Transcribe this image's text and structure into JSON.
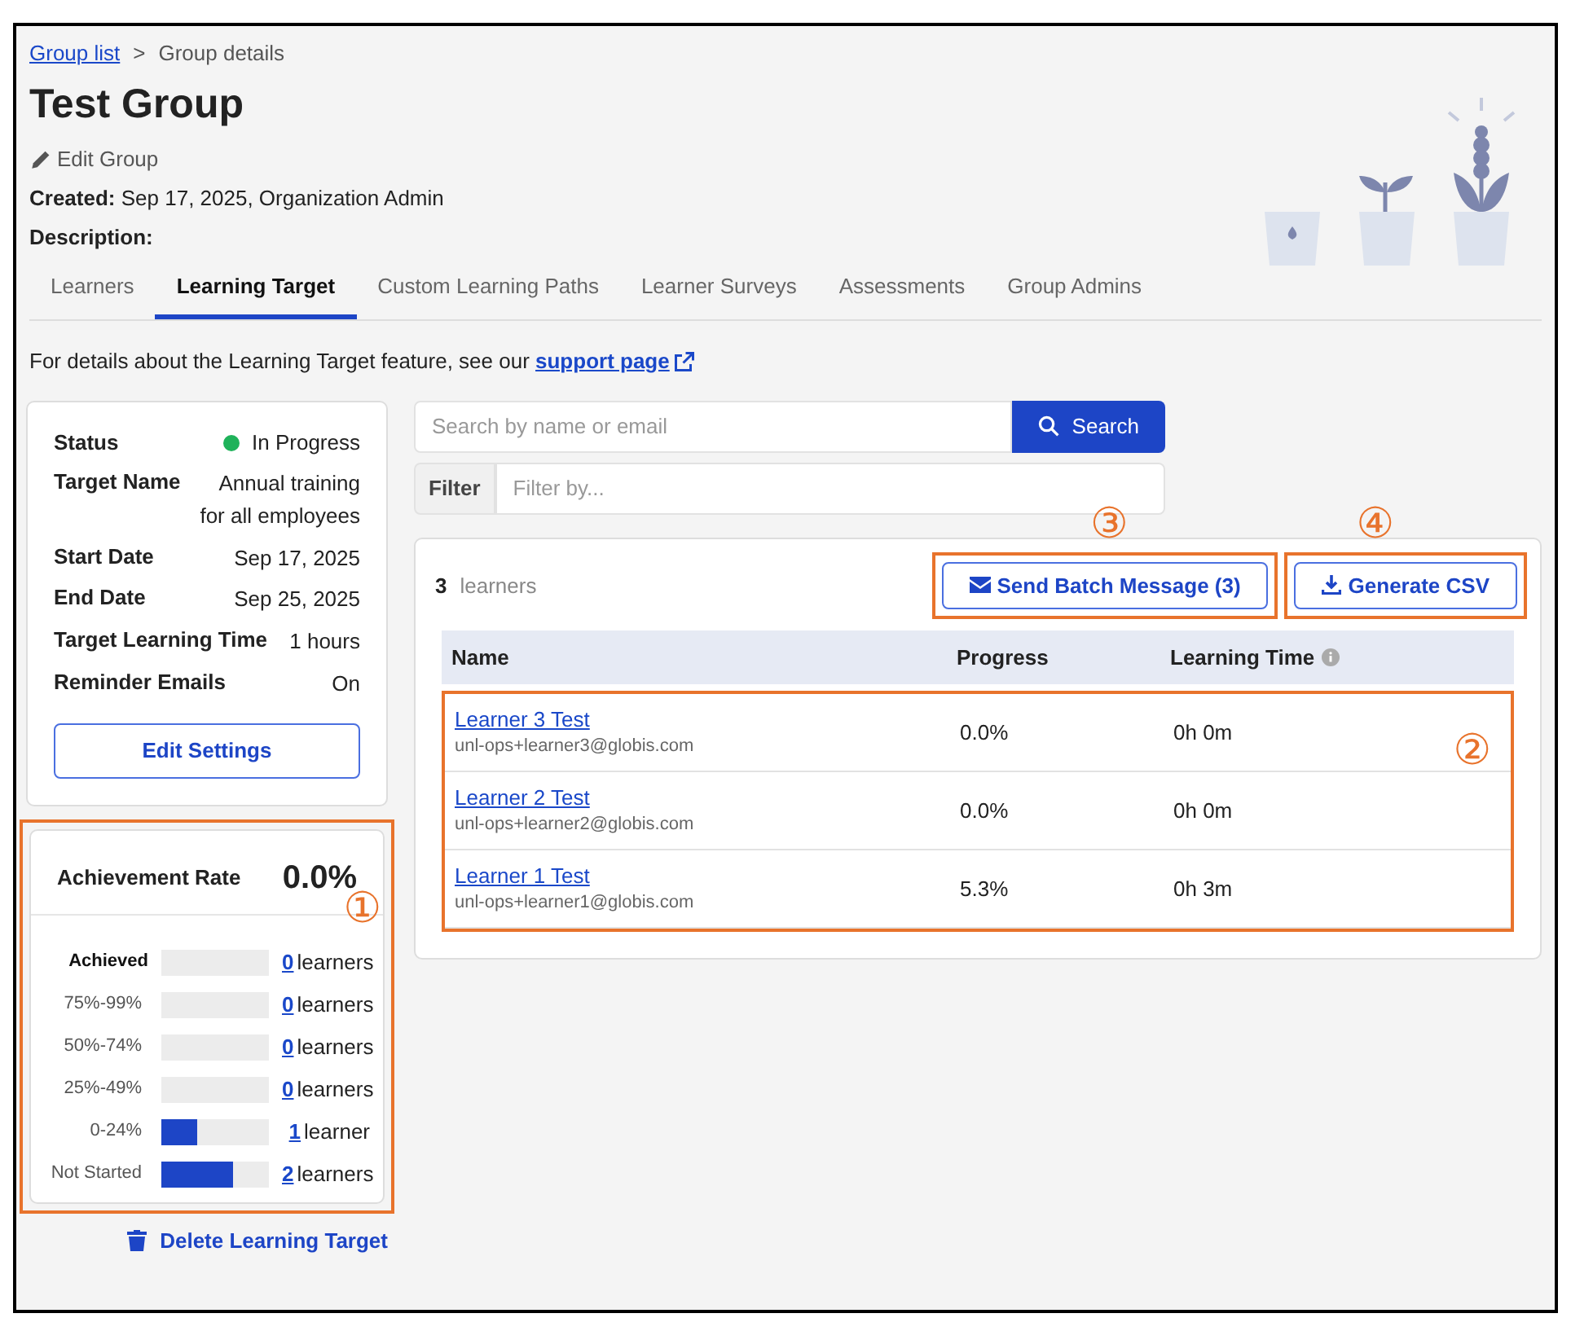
{
  "breadcrumb": {
    "items": [
      {
        "label": "Group list",
        "current": false
      },
      {
        "label": "Group details",
        "current": true
      }
    ],
    "separator": ">"
  },
  "title": "Test Group",
  "edit_link": "Edit Group",
  "created": {
    "label": "Created:",
    "value": "Sep 17, 2025, Organization Admin"
  },
  "description": {
    "label": "Description:"
  },
  "tabs": [
    {
      "label": "Learners",
      "selected": false
    },
    {
      "label": "Learning Target",
      "selected": true
    },
    {
      "label": "Custom Learning Paths",
      "selected": false
    },
    {
      "label": "Learner Surveys",
      "selected": false
    },
    {
      "label": "Assessments",
      "selected": false
    },
    {
      "label": "Group Admins",
      "selected": false
    }
  ],
  "notice": {
    "text": "For details about the Learning Target feature, see our",
    "link": "support page"
  },
  "target": {
    "fields": [
      {
        "kind": "status",
        "label": "Status",
        "value": "In Progress",
        "color": "#1fb25a"
      },
      {
        "kind": "text",
        "label": "Target Name",
        "value": "Annual training for all employees"
      },
      {
        "kind": "text",
        "label": "Start Date",
        "value": "Sep 17, 2025"
      },
      {
        "kind": "text",
        "label": "End Date",
        "value": "Sep 25, 2025"
      },
      {
        "kind": "text",
        "label": "Target Learning Time",
        "value": "1 hours"
      },
      {
        "kind": "text",
        "label": "Reminder Emails",
        "value": "On"
      }
    ],
    "edit_button": "Edit Settings"
  },
  "achievement": {
    "label": "Achievement Rate",
    "value": "0.0%",
    "rows": [
      {
        "label": "Achieved",
        "bold": true,
        "level": 0,
        "count": "0",
        "unit": "learners"
      },
      {
        "label": "75%-99%",
        "bold": false,
        "level": 0,
        "count": "0",
        "unit": "learners"
      },
      {
        "label": "50%-74%",
        "bold": false,
        "level": 0,
        "count": "0",
        "unit": "learners"
      },
      {
        "label": "25%-49%",
        "bold": false,
        "level": 0,
        "count": "0",
        "unit": "learners"
      },
      {
        "label": "0-24%",
        "bold": false,
        "level": 0.33,
        "count": "1",
        "unit": "learner"
      },
      {
        "label": "Not Started",
        "bold": false,
        "level": 0.67,
        "count": "2",
        "unit": "learners"
      }
    ]
  },
  "delete_link": "Delete Learning Target",
  "search": {
    "placeholder": "Search by name or email",
    "button": "Search"
  },
  "filter": {
    "label": "Filter",
    "placeholder": "Filter by..."
  },
  "results": {
    "count": "3",
    "unit": "learners",
    "batch_button": "Send Batch Message (3)",
    "csv_button": "Generate CSV",
    "columns": [
      "Name",
      "Progress",
      "Learning Time"
    ],
    "rows": [
      {
        "name": "Learner 3 Test",
        "email": "unl-ops+learner3@globis.com",
        "progress": "0.0%",
        "time": "0h 0m"
      },
      {
        "name": "Learner 2 Test",
        "email": "unl-ops+learner2@globis.com",
        "progress": "0.0%",
        "time": "0h 0m"
      },
      {
        "name": "Learner 1 Test",
        "email": "unl-ops+learner1@globis.com",
        "progress": "5.3%",
        "time": "0h 3m"
      }
    ]
  },
  "callouts": [
    "①",
    "②",
    "③",
    "④"
  ]
}
